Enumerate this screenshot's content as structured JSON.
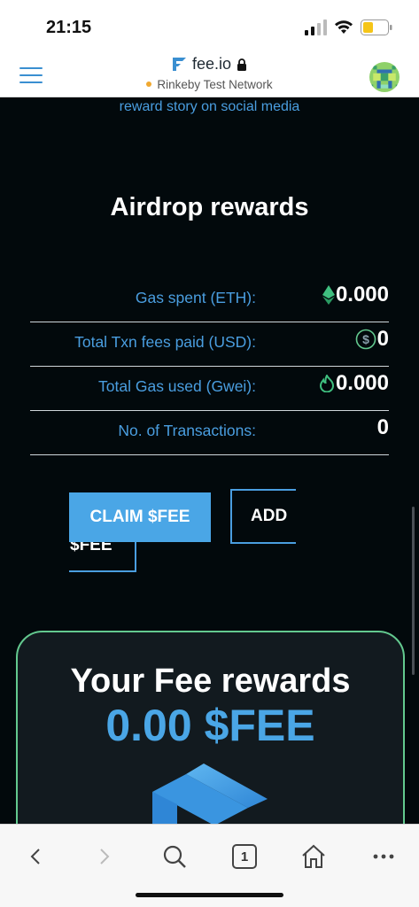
{
  "status_bar": {
    "time": "21:15"
  },
  "header": {
    "site": "fee.io",
    "network": "Rinkeby Test Network"
  },
  "intro_text": "reward story on social media",
  "airdrop": {
    "title": "Airdrop rewards",
    "rows": [
      {
        "label": "Gas spent (ETH):",
        "value": "0.000",
        "icon": "eth-icon"
      },
      {
        "label": "Total Txn fees paid (USD):",
        "value": "0",
        "icon": "dollar-icon"
      },
      {
        "label": "Total Gas used (Gwei):",
        "value": "0.000",
        "icon": "flame-icon"
      },
      {
        "label": "No. of Transactions:",
        "value": "0",
        "icon": ""
      }
    ],
    "claim_label": "CLAIM $FEE",
    "add_line1": "ADD",
    "add_line2": "$FEE"
  },
  "rewards_card": {
    "title": "Your Fee rewards",
    "amount": "0.00 $FEE"
  },
  "bottom_bar": {
    "tab_count": "1"
  },
  "colors": {
    "accent": "#4aa6e6",
    "background": "#02090c",
    "card_border": "#63c98f",
    "eth_green": "#3fbf7f",
    "network_dot": "#f0a830"
  }
}
